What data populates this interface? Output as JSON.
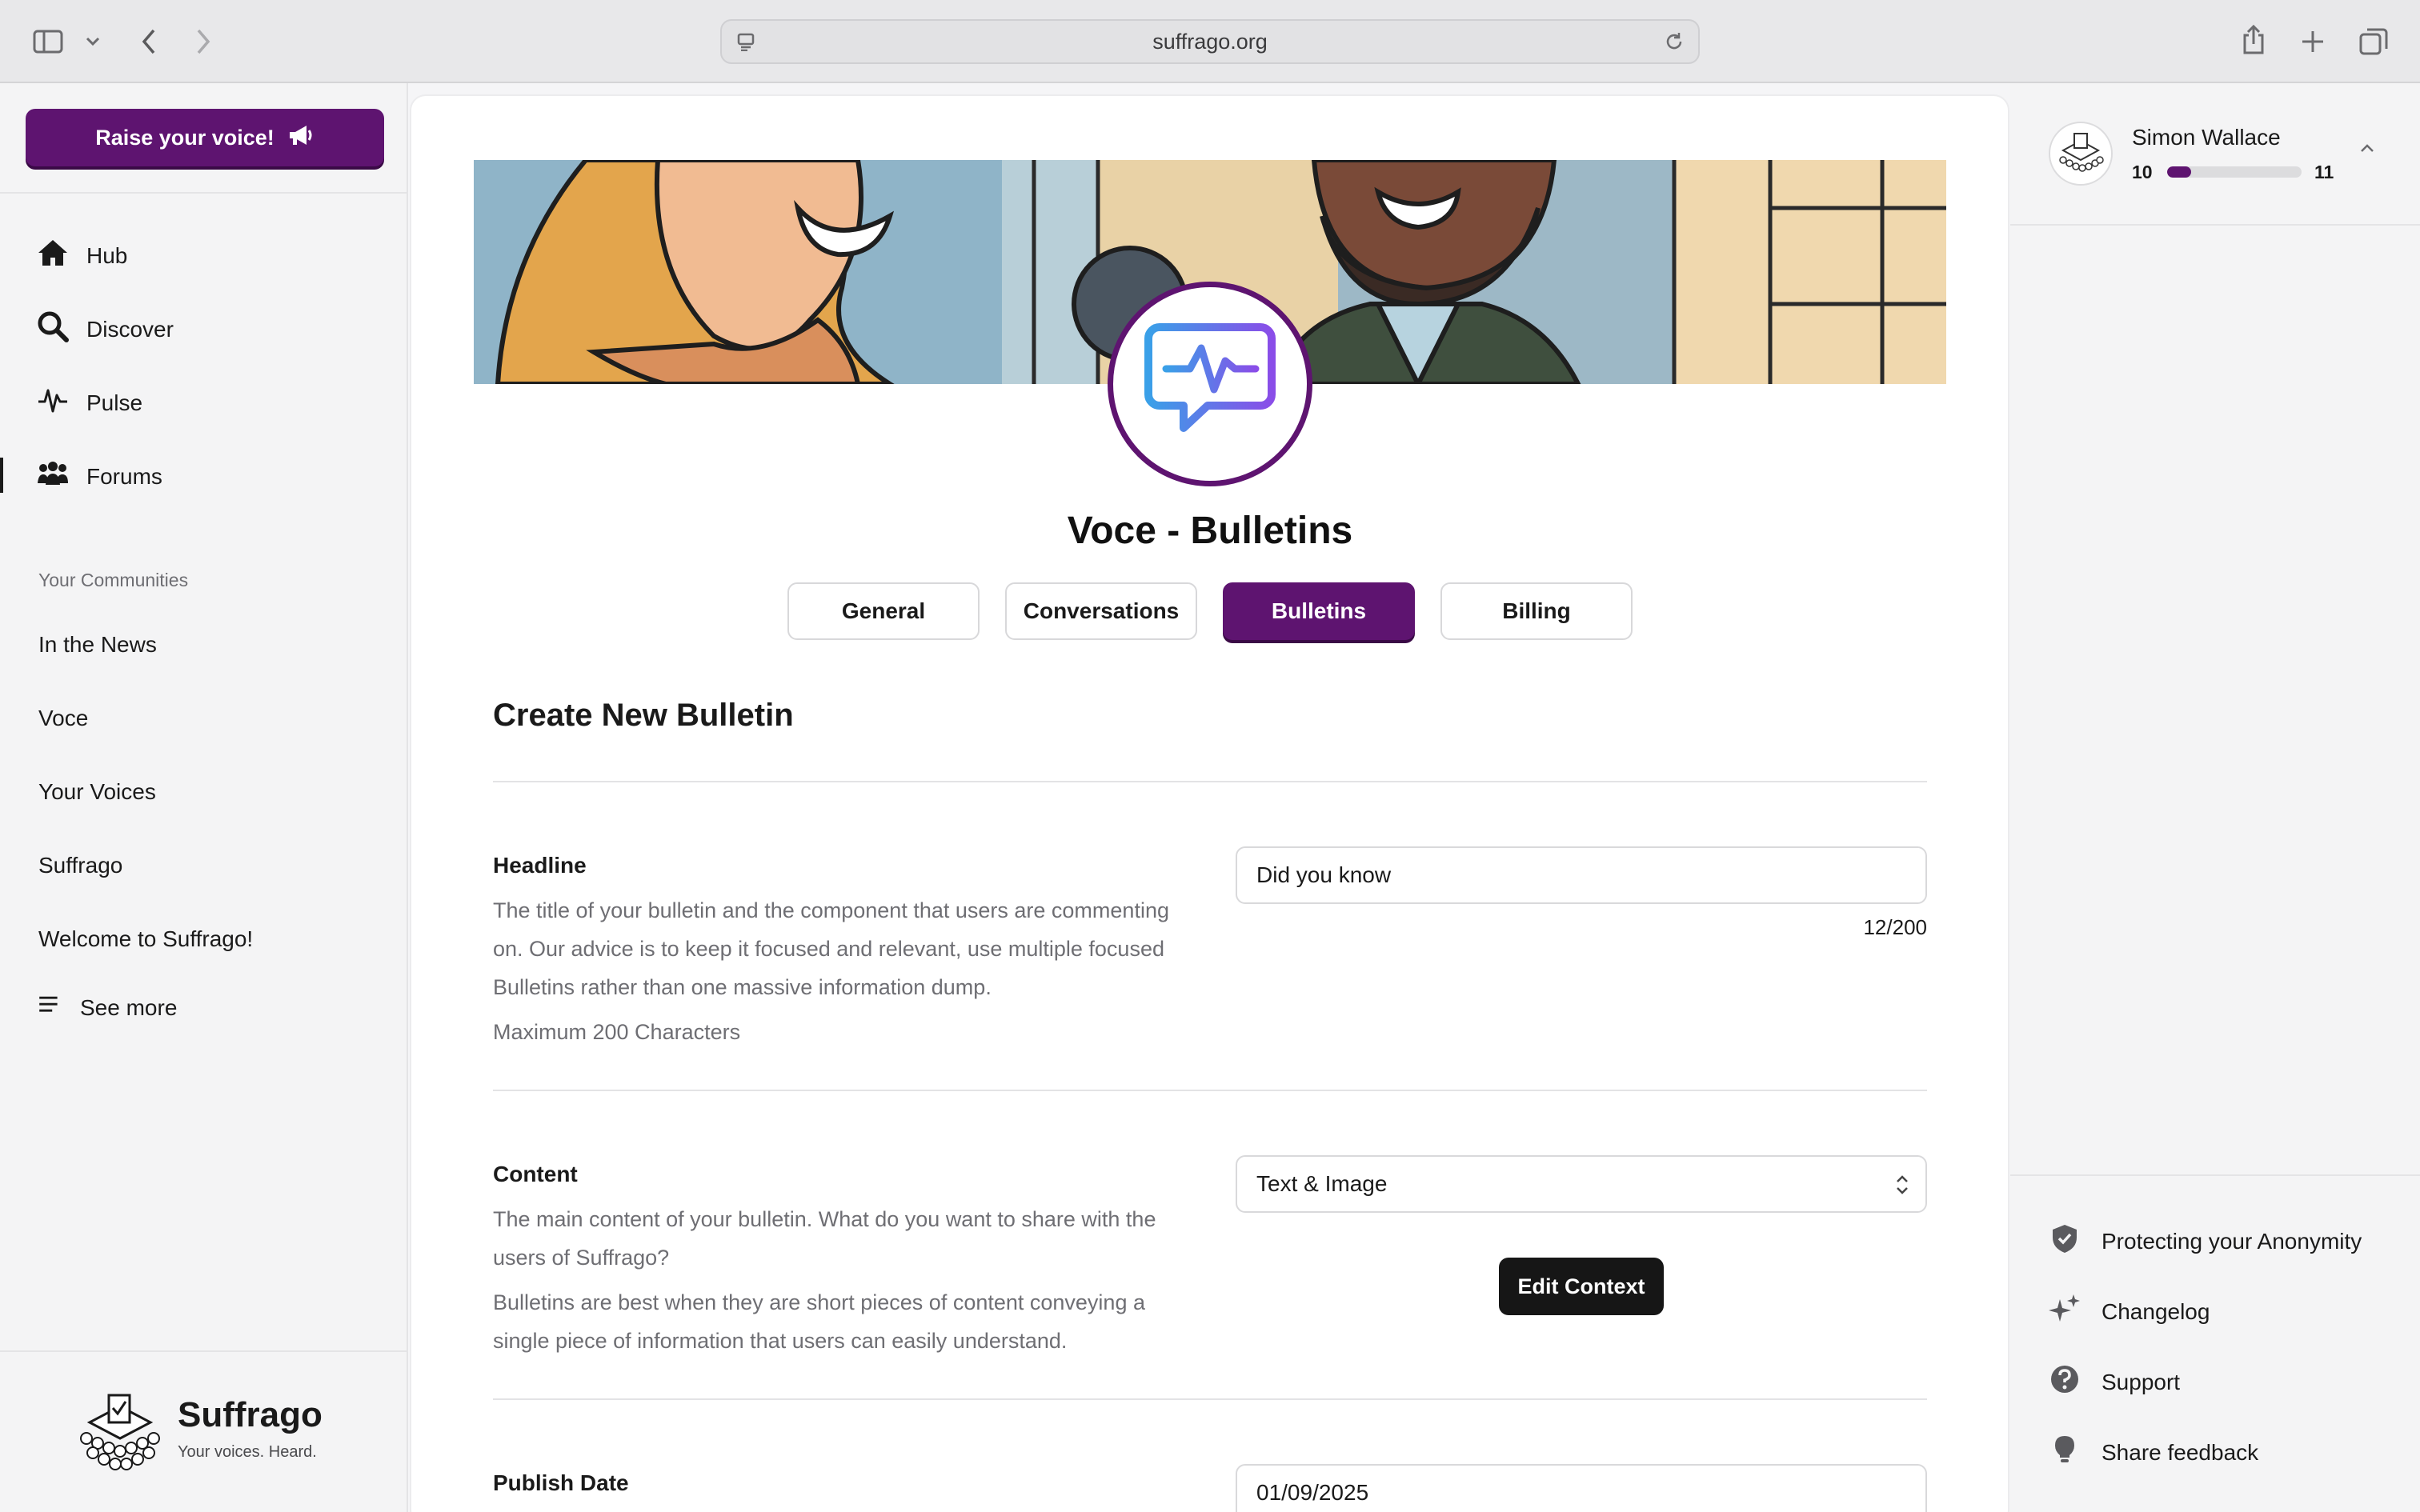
{
  "browser": {
    "url": "suffrago.org"
  },
  "sidebar": {
    "cta_label": "Raise your voice!",
    "nav": [
      {
        "label": "Hub"
      },
      {
        "label": "Discover"
      },
      {
        "label": "Pulse"
      },
      {
        "label": "Forums"
      }
    ],
    "communities_heading": "Your Communities",
    "communities": [
      "In the News",
      "Voce",
      "Your Voices",
      "Suffrago",
      "Welcome to Suffrago!"
    ],
    "see_more": "See more",
    "brand": {
      "name": "Suffrago",
      "tagline": "Your voices. Heard."
    }
  },
  "main": {
    "title": "Voce - Bulletins",
    "tabs": [
      {
        "label": "General"
      },
      {
        "label": "Conversations"
      },
      {
        "label": "Bulletins",
        "active": true
      },
      {
        "label": "Billing"
      }
    ],
    "form_heading": "Create New Bulletin",
    "headline": {
      "label": "Headline",
      "description": "The title of your bulletin and the component that users are commenting on. Our advice is to keep it focused and relevant, use multiple focused Bulletins rather than one massive information dump.",
      "hint": "Maximum 200 Characters",
      "value": "Did you know",
      "counter": "12/200"
    },
    "content": {
      "label": "Content",
      "description1": "The main content of your bulletin. What do you want to share with the users of Suffrago?",
      "description2": "Bulletins are best when they are short pieces of content conveying a single piece of information that users can easily understand.",
      "select_value": "Text & Image",
      "edit_button": "Edit Context"
    },
    "publish": {
      "label": "Publish Date",
      "value": "01/09/2025"
    }
  },
  "user": {
    "name": "Simon Wallace",
    "level_current": "10",
    "level_next": "11",
    "progress_fraction": 0.18
  },
  "right_links": [
    {
      "label": "Protecting your Anonymity"
    },
    {
      "label": "Changelog"
    },
    {
      "label": "Support"
    },
    {
      "label": "Share feedback"
    }
  ],
  "colors": {
    "brand": "#5e1470",
    "dark_button": "#161616"
  }
}
